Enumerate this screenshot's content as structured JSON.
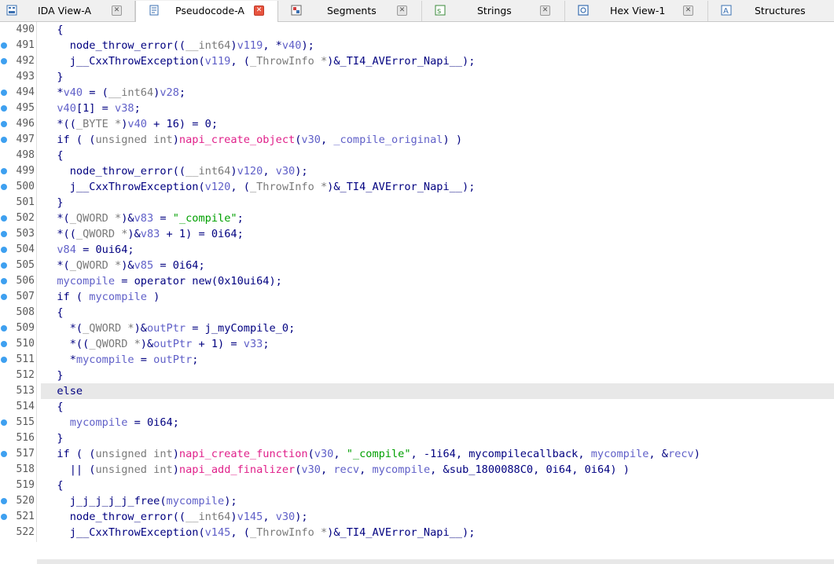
{
  "tabs": [
    {
      "label": "IDA View-A",
      "icon": "ida-view-icon",
      "active": false
    },
    {
      "label": "Pseudocode-A",
      "icon": "pseudocode-icon",
      "active": true
    },
    {
      "label": "Segments",
      "icon": "segments-icon",
      "active": false
    },
    {
      "label": "Strings",
      "icon": "strings-icon",
      "active": false
    },
    {
      "label": "Hex View-1",
      "icon": "hex-view-icon",
      "active": false
    },
    {
      "label": "Structures",
      "icon": "structures-icon",
      "active": false
    }
  ],
  "colors": {
    "breakpoint_dot": "#3ea0f0",
    "active_close": "#e8543f",
    "keyword": "#000080",
    "variable": "#6060c8",
    "import_function": "#e0208a",
    "string": "#00a000",
    "type_cast": "#7a7a7a",
    "highlight_line": "#e8e8e8"
  },
  "code_lines": [
    {
      "n": "490",
      "dot": false,
      "hl": false,
      "indent": 2,
      "tokens": [
        [
          "p",
          "{"
        ]
      ]
    },
    {
      "n": "491",
      "dot": true,
      "hl": false,
      "indent": 4,
      "tokens": [
        [
          "fn",
          "node_throw_error"
        ],
        [
          "p",
          "(("
        ],
        [
          "t",
          "__int64"
        ],
        [
          "p",
          ")"
        ],
        [
          "var",
          "v119"
        ],
        [
          "p",
          ", *"
        ],
        [
          "var",
          "v40"
        ],
        [
          "p",
          ");"
        ]
      ]
    },
    {
      "n": "492",
      "dot": true,
      "hl": false,
      "indent": 4,
      "tokens": [
        [
          "fn",
          "j__CxxThrowException"
        ],
        [
          "p",
          "("
        ],
        [
          "var",
          "v119"
        ],
        [
          "p",
          ", ("
        ],
        [
          "t",
          "_ThrowInfo *"
        ],
        [
          "p",
          ")&"
        ],
        [
          "fn",
          "_TI4_AVError_Napi__"
        ],
        [
          "p",
          ");"
        ]
      ]
    },
    {
      "n": "493",
      "dot": false,
      "hl": false,
      "indent": 2,
      "tokens": [
        [
          "p",
          "}"
        ]
      ]
    },
    {
      "n": "494",
      "dot": true,
      "hl": false,
      "indent": 2,
      "tokens": [
        [
          "p",
          "*"
        ],
        [
          "var",
          "v40"
        ],
        [
          "p",
          " = ("
        ],
        [
          "t",
          "__int64"
        ],
        [
          "p",
          ")"
        ],
        [
          "var",
          "v28"
        ],
        [
          "p",
          ";"
        ]
      ]
    },
    {
      "n": "495",
      "dot": true,
      "hl": false,
      "indent": 2,
      "tokens": [
        [
          "var",
          "v40"
        ],
        [
          "p",
          "[1] = "
        ],
        [
          "var",
          "v38"
        ],
        [
          "p",
          ";"
        ]
      ]
    },
    {
      "n": "496",
      "dot": true,
      "hl": false,
      "indent": 2,
      "tokens": [
        [
          "p",
          "*(("
        ],
        [
          "t",
          "_BYTE *"
        ],
        [
          "p",
          ")"
        ],
        [
          "var",
          "v40"
        ],
        [
          "p",
          " + 16) = 0;"
        ]
      ]
    },
    {
      "n": "497",
      "dot": true,
      "hl": false,
      "indent": 2,
      "tokens": [
        [
          "p",
          "if ( ("
        ],
        [
          "t",
          "unsigned int"
        ],
        [
          "p",
          ")"
        ],
        [
          "imp",
          "napi_create_object"
        ],
        [
          "p",
          "("
        ],
        [
          "var",
          "v30"
        ],
        [
          "p",
          ", "
        ],
        [
          "var",
          "_compile_original"
        ],
        [
          "p",
          ") )"
        ]
      ]
    },
    {
      "n": "498",
      "dot": false,
      "hl": false,
      "indent": 2,
      "tokens": [
        [
          "p",
          "{"
        ]
      ]
    },
    {
      "n": "499",
      "dot": true,
      "hl": false,
      "indent": 4,
      "tokens": [
        [
          "fn",
          "node_throw_error"
        ],
        [
          "p",
          "(("
        ],
        [
          "t",
          "__int64"
        ],
        [
          "p",
          ")"
        ],
        [
          "var",
          "v120"
        ],
        [
          "p",
          ", "
        ],
        [
          "var",
          "v30"
        ],
        [
          "p",
          ");"
        ]
      ]
    },
    {
      "n": "500",
      "dot": true,
      "hl": false,
      "indent": 4,
      "tokens": [
        [
          "fn",
          "j__CxxThrowException"
        ],
        [
          "p",
          "("
        ],
        [
          "var",
          "v120"
        ],
        [
          "p",
          ", ("
        ],
        [
          "t",
          "_ThrowInfo *"
        ],
        [
          "p",
          ")&"
        ],
        [
          "fn",
          "_TI4_AVError_Napi__"
        ],
        [
          "p",
          ");"
        ]
      ]
    },
    {
      "n": "501",
      "dot": false,
      "hl": false,
      "indent": 2,
      "tokens": [
        [
          "p",
          "}"
        ]
      ]
    },
    {
      "n": "502",
      "dot": true,
      "hl": false,
      "indent": 2,
      "tokens": [
        [
          "p",
          "*("
        ],
        [
          "t",
          "_QWORD *"
        ],
        [
          "p",
          ")&"
        ],
        [
          "var",
          "v83"
        ],
        [
          "p",
          " = "
        ],
        [
          "str",
          "\"_compile\""
        ],
        [
          "p",
          ";"
        ]
      ]
    },
    {
      "n": "503",
      "dot": true,
      "hl": false,
      "indent": 2,
      "tokens": [
        [
          "p",
          "*(("
        ],
        [
          "t",
          "_QWORD *"
        ],
        [
          "p",
          ")&"
        ],
        [
          "var",
          "v83"
        ],
        [
          "p",
          " + 1) = 0i64;"
        ]
      ]
    },
    {
      "n": "504",
      "dot": true,
      "hl": false,
      "indent": 2,
      "tokens": [
        [
          "var",
          "v84"
        ],
        [
          "p",
          " = 0ui64;"
        ]
      ]
    },
    {
      "n": "505",
      "dot": true,
      "hl": false,
      "indent": 2,
      "tokens": [
        [
          "p",
          "*("
        ],
        [
          "t",
          "_QWORD *"
        ],
        [
          "p",
          ")&"
        ],
        [
          "var",
          "v85"
        ],
        [
          "p",
          " = 0i64;"
        ]
      ]
    },
    {
      "n": "506",
      "dot": true,
      "hl": false,
      "indent": 2,
      "tokens": [
        [
          "var",
          "mycompile"
        ],
        [
          "p",
          " = "
        ],
        [
          "fn",
          "operator new"
        ],
        [
          "p",
          "(0x10ui64);"
        ]
      ]
    },
    {
      "n": "507",
      "dot": true,
      "hl": false,
      "indent": 2,
      "tokens": [
        [
          "p",
          "if ( "
        ],
        [
          "var",
          "mycompile"
        ],
        [
          "p",
          " )"
        ]
      ]
    },
    {
      "n": "508",
      "dot": false,
      "hl": false,
      "indent": 2,
      "tokens": [
        [
          "p",
          "{"
        ]
      ]
    },
    {
      "n": "509",
      "dot": true,
      "hl": false,
      "indent": 4,
      "tokens": [
        [
          "p",
          "*("
        ],
        [
          "t",
          "_QWORD *"
        ],
        [
          "p",
          ")&"
        ],
        [
          "var",
          "outPtr"
        ],
        [
          "p",
          " = "
        ],
        [
          "fn",
          "j_myCompile_0"
        ],
        [
          "p",
          ";"
        ]
      ]
    },
    {
      "n": "510",
      "dot": true,
      "hl": false,
      "indent": 4,
      "tokens": [
        [
          "p",
          "*(("
        ],
        [
          "t",
          "_QWORD *"
        ],
        [
          "p",
          ")&"
        ],
        [
          "var",
          "outPtr"
        ],
        [
          "p",
          " + 1) = "
        ],
        [
          "var",
          "v33"
        ],
        [
          "p",
          ";"
        ]
      ]
    },
    {
      "n": "511",
      "dot": true,
      "hl": false,
      "indent": 4,
      "tokens": [
        [
          "p",
          "*"
        ],
        [
          "var",
          "mycompile"
        ],
        [
          "p",
          " = "
        ],
        [
          "var",
          "outPtr"
        ],
        [
          "p",
          ";"
        ]
      ]
    },
    {
      "n": "512",
      "dot": false,
      "hl": false,
      "indent": 2,
      "tokens": [
        [
          "p",
          "}"
        ]
      ]
    },
    {
      "n": "513",
      "dot": false,
      "hl": true,
      "indent": 2,
      "tokens": [
        [
          "p",
          "else"
        ]
      ]
    },
    {
      "n": "514",
      "dot": false,
      "hl": false,
      "indent": 2,
      "tokens": [
        [
          "p",
          "{"
        ]
      ]
    },
    {
      "n": "515",
      "dot": true,
      "hl": false,
      "indent": 4,
      "tokens": [
        [
          "var",
          "mycompile"
        ],
        [
          "p",
          " = 0i64;"
        ]
      ]
    },
    {
      "n": "516",
      "dot": false,
      "hl": false,
      "indent": 2,
      "tokens": [
        [
          "p",
          "}"
        ]
      ]
    },
    {
      "n": "517",
      "dot": true,
      "hl": false,
      "indent": 2,
      "tokens": [
        [
          "p",
          "if ( ("
        ],
        [
          "t",
          "unsigned int"
        ],
        [
          "p",
          ")"
        ],
        [
          "imp",
          "napi_create_function"
        ],
        [
          "p",
          "("
        ],
        [
          "var",
          "v30"
        ],
        [
          "p",
          ", "
        ],
        [
          "str",
          "\"_compile\""
        ],
        [
          "p",
          ", -1i64, "
        ],
        [
          "fn",
          "mycompilecallback"
        ],
        [
          "p",
          ", "
        ],
        [
          "var",
          "mycompile"
        ],
        [
          "p",
          ", &"
        ],
        [
          "var",
          "recv"
        ],
        [
          "p",
          ")"
        ]
      ]
    },
    {
      "n": "518",
      "dot": false,
      "hl": false,
      "indent": 4,
      "tokens": [
        [
          "p",
          "|| ("
        ],
        [
          "t",
          "unsigned int"
        ],
        [
          "p",
          ")"
        ],
        [
          "imp",
          "napi_add_finalizer"
        ],
        [
          "p",
          "("
        ],
        [
          "var",
          "v30"
        ],
        [
          "p",
          ", "
        ],
        [
          "var",
          "recv"
        ],
        [
          "p",
          ", "
        ],
        [
          "var",
          "mycompile"
        ],
        [
          "p",
          ", &"
        ],
        [
          "fn",
          "sub_1800088C0"
        ],
        [
          "p",
          ", 0i64, 0i64) )"
        ]
      ]
    },
    {
      "n": "519",
      "dot": false,
      "hl": false,
      "indent": 2,
      "tokens": [
        [
          "p",
          "{"
        ]
      ]
    },
    {
      "n": "520",
      "dot": true,
      "hl": false,
      "indent": 4,
      "tokens": [
        [
          "fn",
          "j_j_j_j_j_free"
        ],
        [
          "p",
          "("
        ],
        [
          "var",
          "mycompile"
        ],
        [
          "p",
          ");"
        ]
      ]
    },
    {
      "n": "521",
      "dot": true,
      "hl": false,
      "indent": 4,
      "tokens": [
        [
          "fn",
          "node_throw_error"
        ],
        [
          "p",
          "(("
        ],
        [
          "t",
          "__int64"
        ],
        [
          "p",
          ")"
        ],
        [
          "var",
          "v145"
        ],
        [
          "p",
          ", "
        ],
        [
          "var",
          "v30"
        ],
        [
          "p",
          ");"
        ]
      ]
    },
    {
      "n": "522",
      "dot": false,
      "hl": false,
      "indent": 4,
      "tokens": [
        [
          "fn",
          "j__CxxThrowException"
        ],
        [
          "p",
          "("
        ],
        [
          "var",
          "v145"
        ],
        [
          "p",
          ", ("
        ],
        [
          "t",
          "_ThrowInfo *"
        ],
        [
          "p",
          ")&"
        ],
        [
          "fn",
          "_TI4_AVError_Napi__"
        ],
        [
          "p",
          ");"
        ]
      ]
    }
  ]
}
